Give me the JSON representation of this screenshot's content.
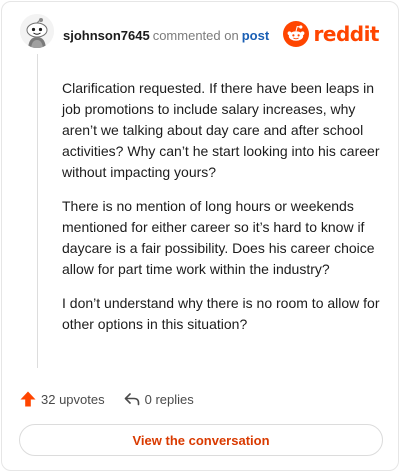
{
  "header": {
    "username": "sjohnson7645",
    "action_text": "commented on",
    "post_link": "post",
    "brand_name": "reddit",
    "brand_color": "#ff4500",
    "avatar_icon": "snoo-avatar-icon"
  },
  "comment": {
    "paragraphs": [
      "Clarification requested. If there have been leaps in job promotions to include salary increases, why aren’t we talking about day care and after school activities? Why can’t he start looking into his career without impacting yours?",
      "There is no mention of long hours or weekends mentioned for either career so it’s hard to know if daycare is a fair possibility. Does his career choice allow for part time work within the industry?",
      "I don’t understand why there is no room to allow for other options in this situation?"
    ]
  },
  "footer": {
    "upvotes": "32 upvotes",
    "replies": "0 replies",
    "view_button": "View the conversation",
    "upvote_icon": "upvote-arrow-icon",
    "reply_icon": "reply-arrow-icon",
    "accent_color": "#d93a00"
  }
}
